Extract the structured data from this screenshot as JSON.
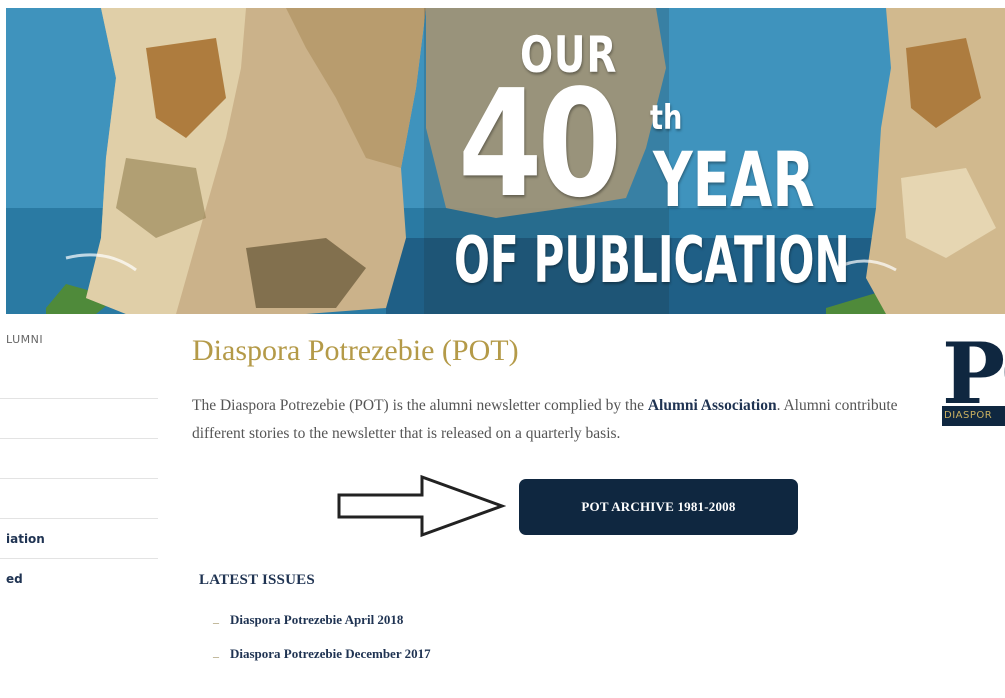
{
  "hero": {
    "line_our": "OUR",
    "line_number": "40",
    "line_superscript": "th",
    "line_year": "YEAR",
    "line_publication": "OF PUBLICATION"
  },
  "sidebar": {
    "heading": "LUMNI",
    "items": [
      {
        "label": "iation"
      },
      {
        "label": "ed"
      }
    ]
  },
  "main": {
    "title": "Diaspora Potrezebie (POT)",
    "intro_part1": "The Diaspora Potrezebie (POT) is the alumni newsletter complied by the ",
    "intro_link": "Alumni Association",
    "intro_part2": ". Alumni contribute different stories to the newsletter that is released on a quarterly basis.",
    "archive_button": "POT ARCHIVE 1981-2008",
    "latest_heading": "LATEST ISSUES",
    "issues": [
      {
        "label": "Diaspora Potrezebie April 2018"
      },
      {
        "label": "Diaspora Potrezebie December 2017"
      }
    ],
    "bullet_glyph": "–"
  },
  "logo": {
    "letters": "PO",
    "subtitle": "DIASPOR",
    "navy": "#0f2740",
    "gold": "#c9b060"
  },
  "colors": {
    "title_gold": "#b49a48",
    "link_navy": "#1f3352",
    "button_navy": "#0f2740"
  }
}
